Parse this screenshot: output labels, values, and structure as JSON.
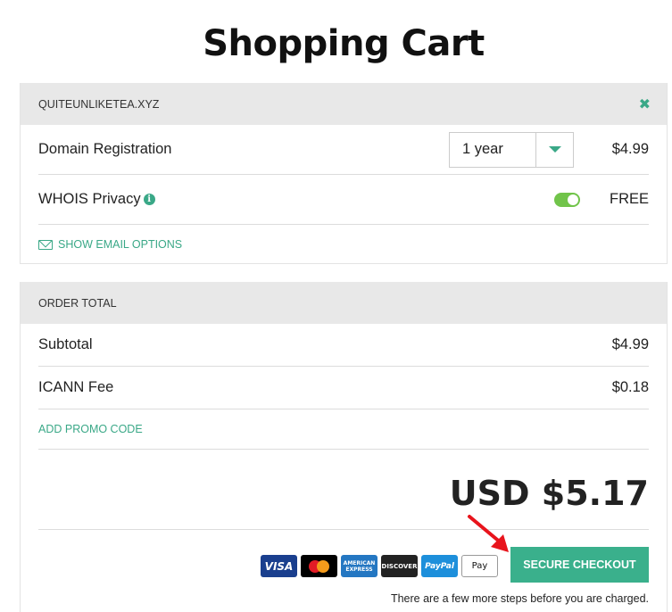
{
  "page": {
    "title": "Shopping Cart"
  },
  "domain_card": {
    "domain": "QUITEUNLIKETEA.XYZ",
    "close_icon": "close-icon",
    "registration": {
      "label": "Domain Registration",
      "term": "1 year",
      "price": "$4.99"
    },
    "privacy": {
      "label": "WHOIS Privacy",
      "toggle_on": true,
      "price": "FREE"
    },
    "email_link": "SHOW EMAIL OPTIONS"
  },
  "order_card": {
    "header": "ORDER TOTAL",
    "subtotal": {
      "label": "Subtotal",
      "value": "$4.99"
    },
    "icann": {
      "label": "ICANN Fee",
      "value": "$0.18"
    },
    "promo_link": "ADD PROMO CODE",
    "total": "USD $5.17"
  },
  "payment": {
    "visa": "VISA",
    "amex_line1": "AMERICAN",
    "amex_line2": "EXPRESS",
    "discover": "DISCOVER",
    "paypal": "PayPal",
    "applepay": "Pay"
  },
  "checkout": {
    "button_label": "SECURE CHECKOUT",
    "note": "There are a few more steps before you are charged."
  },
  "colors": {
    "accent": "#3ab08c",
    "toggle": "#71c44a",
    "annotation_arrow": "#e8141c"
  }
}
